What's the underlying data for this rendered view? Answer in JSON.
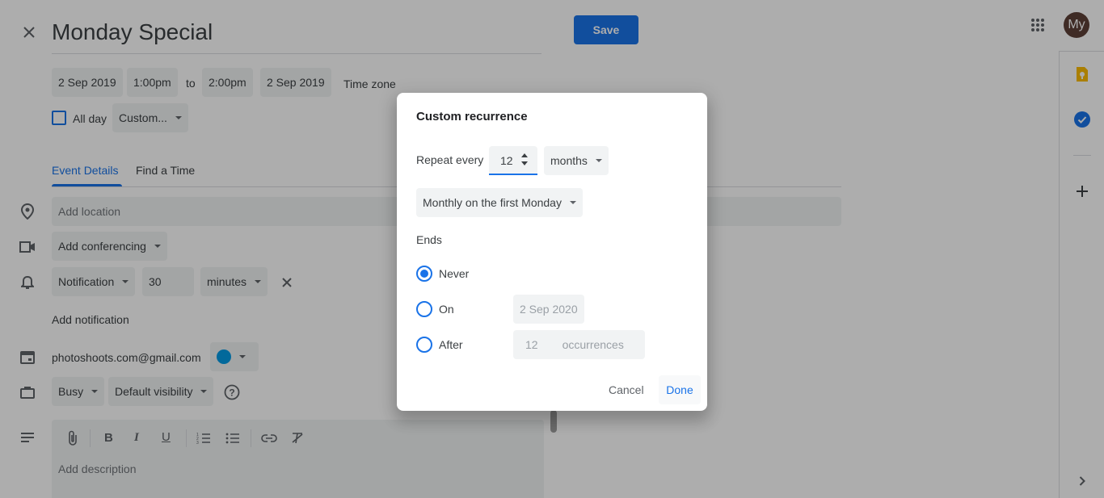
{
  "header": {
    "title": "Monday Special",
    "save_label": "Save",
    "avatar_initials": "My"
  },
  "datetime": {
    "start_date": "2 Sep 2019",
    "start_time": "1:00pm",
    "to_label": "to",
    "end_time": "2:00pm",
    "end_date": "2 Sep 2019",
    "timezone_label": "Time zone",
    "allday_label": "All day",
    "recurrence_value": "Custom..."
  },
  "tabs": [
    {
      "label": "Event Details",
      "active": true
    },
    {
      "label": "Find a Time",
      "active": false
    }
  ],
  "details": {
    "location_placeholder": "Add location",
    "conferencing_label": "Add conferencing",
    "notification_type": "Notification",
    "notification_value": "30",
    "notification_unit": "minutes",
    "add_notification_label": "Add notification",
    "calendar_email": "photoshoots.com@gmail.com",
    "calendar_color": "#039be5",
    "availability": "Busy",
    "visibility": "Default visibility",
    "description_placeholder": "Add description"
  },
  "dialog": {
    "title": "Custom recurrence",
    "repeat_every_label": "Repeat every",
    "repeat_interval": "12",
    "repeat_unit": "months",
    "monthly_option": "Monthly on the first Monday",
    "ends_label": "Ends",
    "never_label": "Never",
    "on_label": "On",
    "on_date": "2 Sep 2020",
    "after_label": "After",
    "after_count": "12",
    "occurrences_label": "occurrences",
    "selected_end": "never",
    "cancel_label": "Cancel",
    "done_label": "Done"
  },
  "colors": {
    "accent": "#1a73e8",
    "save_button": "#1a73e8",
    "avatar_bg": "#5d4037",
    "keep_icon": "#fbbc04",
    "tasks_icon": "#1a73e8"
  },
  "icons": [
    "close-icon",
    "location-icon",
    "video-icon",
    "bell-icon",
    "calendar-icon",
    "briefcase-icon",
    "help-icon",
    "description-icon",
    "attach-icon",
    "bold-icon",
    "italic-icon",
    "underline-icon",
    "numbered-list-icon",
    "bullet-list-icon",
    "link-icon",
    "clear-format-icon",
    "apps-grid-icon",
    "keep-icon",
    "tasks-icon",
    "add-icon",
    "chevron-right-icon"
  ]
}
